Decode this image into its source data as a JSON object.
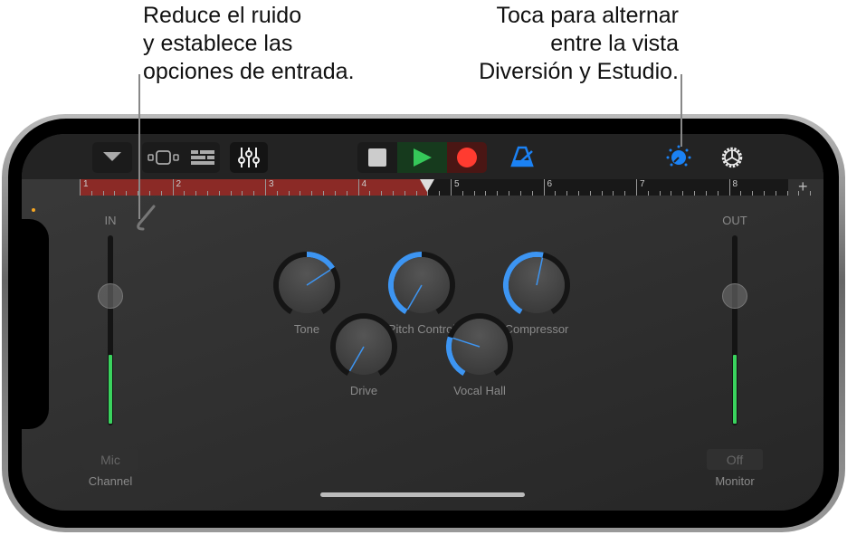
{
  "callouts": {
    "left": [
      "Reduce el ruido",
      "y establece las",
      "opciones de entrada."
    ],
    "right": [
      "Toca para alternar",
      "entre la vista",
      "Diversión y Estudio."
    ]
  },
  "toolbar": {
    "icons": [
      "dropdown-icon",
      "tracks-view-icon",
      "track-list-icon",
      "mixer-icon",
      "stop-icon",
      "play-icon",
      "record-icon",
      "metronome-icon",
      "fun-studio-toggle-icon",
      "settings-icon"
    ],
    "accent": "#1b82f5",
    "play_color": "#35c759",
    "record_color": "#ff3b30"
  },
  "ruler": {
    "bars": [
      "1",
      "2",
      "3",
      "4",
      "5",
      "6",
      "7",
      "8"
    ],
    "cycle_end_bar": 4.75,
    "add_label": "+"
  },
  "input": {
    "label": "IN",
    "level": 0.37,
    "slider": 0.68,
    "channel_value": "Mic",
    "channel_label": "Channel"
  },
  "output": {
    "label": "OUT",
    "level": 0.37,
    "slider": 0.68,
    "monitor_value": "Off",
    "monitor_label": "Monitor"
  },
  "knobs": [
    {
      "label": "Tone",
      "value": 0.69,
      "bipolar": true
    },
    {
      "label": "Pitch Control",
      "value": 0.0,
      "bipolar": true
    },
    {
      "label": "Compressor",
      "value": 0.54,
      "bipolar": false
    },
    {
      "label": "Drive",
      "value": 0.0,
      "bipolar": false
    },
    {
      "label": "Vocal Hall",
      "value": 0.26,
      "bipolar": false
    }
  ]
}
